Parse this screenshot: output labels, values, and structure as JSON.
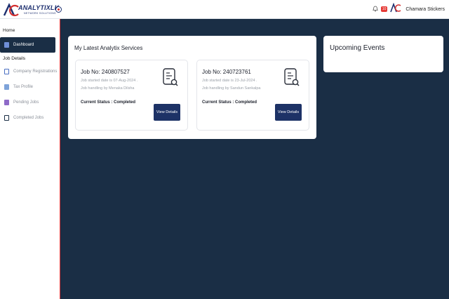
{
  "header": {
    "brand_name": "ANALYTIXLK",
    "brand_tagline": "NETWORK SOLUTIONS",
    "notification_count": "10",
    "user_name": "Chamara Stickers"
  },
  "sidebar": {
    "home_label": "Home",
    "job_details_label": "Job Details",
    "items": [
      {
        "label": "Dashboard",
        "icon": "dashboard-icon"
      },
      {
        "label": "Company Registrations",
        "icon": "registrations-icon"
      },
      {
        "label": "Tax Profile",
        "icon": "tax-profile-icon"
      },
      {
        "label": "Pending Jobs",
        "icon": "pending-jobs-icon"
      },
      {
        "label": "Completed Jobs",
        "icon": "completed-jobs-icon"
      }
    ]
  },
  "services": {
    "title": "My Latest Analytix Services",
    "jobs": [
      {
        "job_no": "Job No: 240807527",
        "started": "Job started date is 07-Aug-2024 .",
        "handler": "Job handling by Menaka Dilsha",
        "status": "Current Status : Completed",
        "button": "View Details"
      },
      {
        "job_no": "Job No: 240723761",
        "started": "Job started date is 23-Jul-2024 .",
        "handler": "Job handling by Sandun Sankalpa",
        "status": "Current Status : Completed",
        "button": "View Details"
      }
    ]
  },
  "events": {
    "title": "Upcoming Events"
  },
  "colors": {
    "navy": "#1a2e45",
    "button": "#1d3266",
    "accent_red": "#e53935"
  }
}
